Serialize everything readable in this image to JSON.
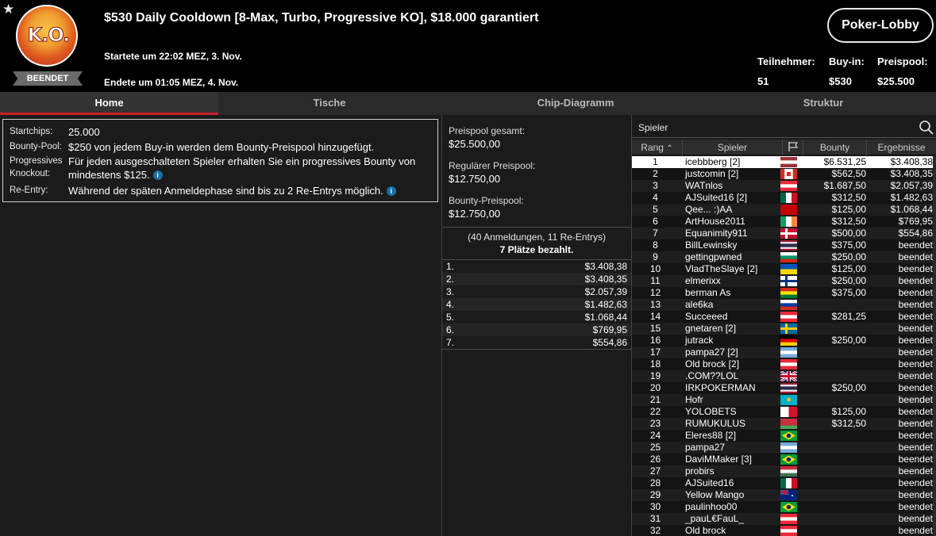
{
  "header": {
    "logo_text": "K.O.",
    "status_badge": "BEENDET",
    "title": "$530 Daily Cooldown [8-Max, Turbo, Progressive KO], $18.000 garantiert",
    "started": "Startete um 22:02 MEZ, 3. Nov.",
    "ended": "Endete um 01:05 MEZ, 4. Nov.",
    "lobby_button": "Poker-Lobby",
    "stats": [
      {
        "label": "Teilnehmer:",
        "value": "51"
      },
      {
        "label": "Buy-in:",
        "value": "$530"
      },
      {
        "label": "Preispool:",
        "value": "$25.500"
      }
    ]
  },
  "tabs": [
    "Home",
    "Tische",
    "Chip-Diagramm",
    "Struktur"
  ],
  "info": {
    "startchips_label": "Startchips:",
    "startchips_value": "25.000",
    "bounty_label": "Bounty-Pool:",
    "bounty_value": "$250 von jedem Buy-in werden dem Bounty-Preispool hinzugefügt.",
    "pko_label_1": "Progressives",
    "pko_label_2": "Knockout:",
    "pko_value": "Für jeden ausgeschalteten Spieler erhalten Sie ein progressives Bounty von mindestens $125.",
    "reentry_label": "Re-Entry:",
    "reentry_value": "Während der späten Anmeldephase sind bis zu 2 Re-Entrys möglich."
  },
  "prizepool": {
    "total_label": "Preispool gesamt:",
    "total_value": "$25.500,00",
    "regular_label": "Regulärer Preispool:",
    "regular_value": "$12.750,00",
    "bounty_label": "Bounty-Preispool:",
    "bounty_value": "$12.750,00",
    "registrations": "(40 Anmeldungen, 11 Re-Entrys)",
    "paid_places": "7 Plätze bezahlt.",
    "payouts": [
      {
        "place": "1.",
        "amount": "$3.408,38"
      },
      {
        "place": "2.",
        "amount": "$3.408,35"
      },
      {
        "place": "3.",
        "amount": "$2.057,39"
      },
      {
        "place": "4.",
        "amount": "$1.482,63"
      },
      {
        "place": "5.",
        "amount": "$1.068,44"
      },
      {
        "place": "6.",
        "amount": "$769,95"
      },
      {
        "place": "7.",
        "amount": "$554,86"
      }
    ]
  },
  "players": {
    "search_placeholder": "Spieler",
    "col_rank": "Rang",
    "col_player": "Spieler",
    "col_bounty": "Bounty",
    "col_result": "Ergebnisse",
    "rows": [
      {
        "rank": "1",
        "name": "icebbberg [2]",
        "flag": "latvia",
        "bounty": "$6.531,25",
        "result": "$3.408,38"
      },
      {
        "rank": "2",
        "name": "justcomin [2]",
        "flag": "canada",
        "bounty": "$562,50",
        "result": "$3.408,35"
      },
      {
        "rank": "3",
        "name": "WATnlos",
        "flag": "austria",
        "bounty": "$1.687,50",
        "result": "$2.057,39"
      },
      {
        "rank": "4",
        "name": "AJSuited16 [2]",
        "flag": "mexico",
        "bounty": "$312,50",
        "result": "$1.482,63"
      },
      {
        "rank": "5",
        "name": "Qee... :)AA",
        "flag": "montenegro",
        "bounty": "$125,00",
        "result": "$1.068,44"
      },
      {
        "rank": "6",
        "name": "ArtHouse2011",
        "flag": "ireland",
        "bounty": "$312,50",
        "result": "$769,95"
      },
      {
        "rank": "7",
        "name": "Equanimity911",
        "flag": "denmark",
        "bounty": "$500,00",
        "result": "$554,86"
      },
      {
        "rank": "8",
        "name": "BillLewinsky",
        "flag": "thailand",
        "bounty": "$375,00",
        "result": "beendet"
      },
      {
        "rank": "9",
        "name": "gettingpwned",
        "flag": "bulgaria",
        "bounty": "$250,00",
        "result": "beendet"
      },
      {
        "rank": "10",
        "name": "VladTheSlaye [2]",
        "flag": "ukraine",
        "bounty": "$125,00",
        "result": "beendet"
      },
      {
        "rank": "11",
        "name": "elmerixx",
        "flag": "finland",
        "bounty": "$250,00",
        "result": "beendet"
      },
      {
        "rank": "12",
        "name": "berman As",
        "flag": "bolivia",
        "bounty": "$375,00",
        "result": "beendet"
      },
      {
        "rank": "13",
        "name": "ale6ka",
        "flag": "russia",
        "bounty": "",
        "result": "beendet"
      },
      {
        "rank": "14",
        "name": "Succeeed",
        "flag": "austria",
        "bounty": "$281,25",
        "result": "beendet"
      },
      {
        "rank": "15",
        "name": "gnetaren [2]",
        "flag": "sweden",
        "bounty": "",
        "result": "beendet"
      },
      {
        "rank": "16",
        "name": "jutrack",
        "flag": "germany",
        "bounty": "$250,00",
        "result": "beendet"
      },
      {
        "rank": "17",
        "name": "pampa27 [2]",
        "flag": "argentina",
        "bounty": "",
        "result": "beendet"
      },
      {
        "rank": "18",
        "name": "Old brock [2]",
        "flag": "austria",
        "bounty": "",
        "result": "beendet"
      },
      {
        "rank": "19",
        "name": ".COM??LOL",
        "flag": "uk",
        "bounty": "",
        "result": "beendet"
      },
      {
        "rank": "20",
        "name": "IRKPOKERMAN",
        "flag": "thailand",
        "bounty": "$250,00",
        "result": "beendet"
      },
      {
        "rank": "21",
        "name": "Hofr",
        "flag": "kazakhstan",
        "bounty": "",
        "result": "beendet"
      },
      {
        "rank": "22",
        "name": "YOLOBETS",
        "flag": "malta",
        "bounty": "$125,00",
        "result": "beendet"
      },
      {
        "rank": "23",
        "name": "RUMUKULUS",
        "flag": "belarus",
        "bounty": "$312,50",
        "result": "beendet"
      },
      {
        "rank": "24",
        "name": "Eleres88 [2]",
        "flag": "brazil",
        "bounty": "",
        "result": "beendet"
      },
      {
        "rank": "25",
        "name": "pampa27",
        "flag": "argentina",
        "bounty": "",
        "result": "beendet"
      },
      {
        "rank": "26",
        "name": "DaviMMaker [3]",
        "flag": "brazil",
        "bounty": "",
        "result": "beendet"
      },
      {
        "rank": "27",
        "name": "probirs",
        "flag": "hungary",
        "bounty": "",
        "result": "beendet"
      },
      {
        "rank": "28",
        "name": "AJSuited16",
        "flag": "mexico",
        "bounty": "",
        "result": "beendet"
      },
      {
        "rank": "29",
        "name": "Yellow Mango",
        "flag": "australia",
        "bounty": "",
        "result": "beendet"
      },
      {
        "rank": "30",
        "name": "paulinhoo00",
        "flag": "brazil",
        "bounty": "",
        "result": "beendet"
      },
      {
        "rank": "31",
        "name": "_pauL€FauL_",
        "flag": "austria",
        "bounty": "",
        "result": "beendet"
      },
      {
        "rank": "32",
        "name": "Old brock",
        "flag": "austria",
        "bounty": "",
        "result": "beendet"
      }
    ]
  }
}
